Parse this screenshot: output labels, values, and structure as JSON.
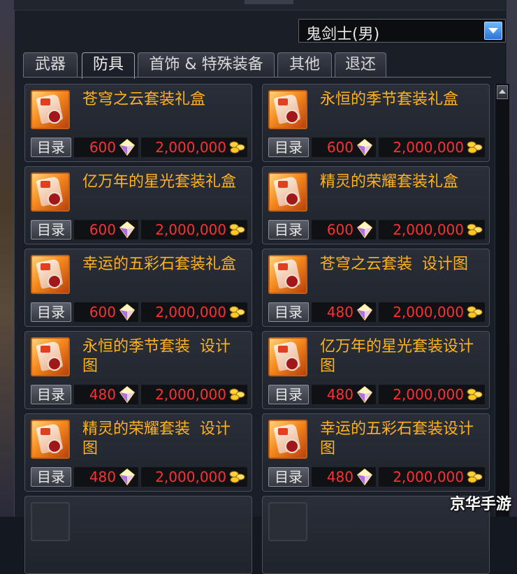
{
  "character_select": {
    "value": "鬼剑士(男)"
  },
  "tabs": [
    {
      "label": "武器"
    },
    {
      "label": "防具"
    },
    {
      "label": "首饰 & 特殊装备"
    },
    {
      "label": "其他"
    },
    {
      "label": "退还"
    }
  ],
  "active_tab": "防具",
  "catalog_label": "目录",
  "items": [
    {
      "name": "苍穹之云套装礼盒",
      "price": "600",
      "gold": "2,000,000"
    },
    {
      "name": "永恒的季节套装礼盒",
      "price": "600",
      "gold": "2,000,000"
    },
    {
      "name": "亿万年的星光套装礼盒",
      "price": "600",
      "gold": "2,000,000"
    },
    {
      "name": "精灵的荣耀套装礼盒",
      "price": "600",
      "gold": "2,000,000"
    },
    {
      "name": "幸运的五彩石套装礼盒",
      "price": "600",
      "gold": "2,000,000"
    },
    {
      "name": "苍穹之云套装  设计图",
      "price": "480",
      "gold": "2,000,000"
    },
    {
      "name": "永恒的季节套装  设计图",
      "price": "480",
      "gold": "2,000,000"
    },
    {
      "name": "亿万年的星光套装设计图",
      "price": "480",
      "gold": "2,000,000"
    },
    {
      "name": "精灵的荣耀套装  设计图",
      "price": "480",
      "gold": "2,000,000"
    },
    {
      "name": "幸运的五彩石套装设计图",
      "price": "480",
      "gold": "2,000,000"
    }
  ],
  "icons": {
    "price_currency": "diamond-icon",
    "gold_currency": "gold-coin-icon",
    "dropdown": "chevron-down-icon",
    "scroll": "scroll-up-icon"
  },
  "colors": {
    "item_name": "#ffb21f",
    "price": "#ff3030",
    "dropdown_button": "#2b74d6"
  },
  "watermark": "京华手游"
}
